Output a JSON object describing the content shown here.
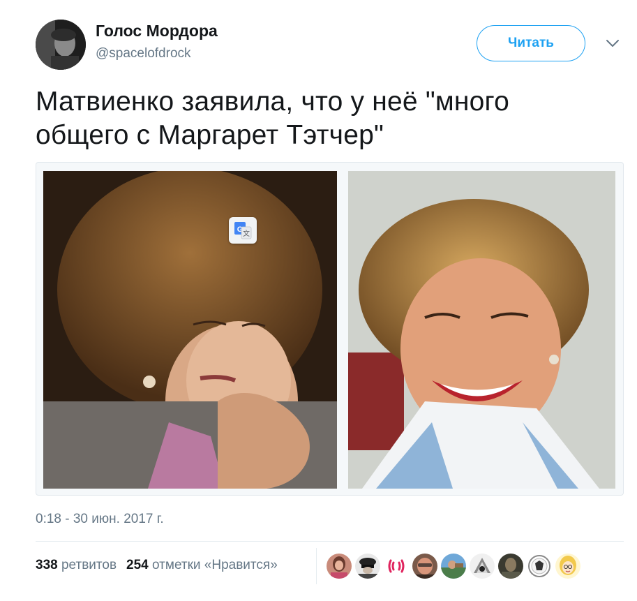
{
  "tweet": {
    "author": {
      "name": "Голос Мордора",
      "handle": "@spacelofdrock"
    },
    "follow_label": "Читать",
    "text": "Матвиенко заявила, что у неё \"много общего с Маргарет Тэтчер\"",
    "timestamp": "0:18 - 30 июн. 2017 г.",
    "stats": {
      "retweets_count": "338",
      "retweets_label": "ретвитов",
      "likes_count": "254",
      "likes_label": "отметки «Нравится»"
    },
    "likers_count_shown": 9
  },
  "icons": {
    "more": "chevron-down-icon",
    "translate": "google-translate-icon"
  },
  "colors": {
    "accent": "#1da1f2",
    "text": "#14171a",
    "secondary": "#657786",
    "border": "#e1e8ed"
  }
}
